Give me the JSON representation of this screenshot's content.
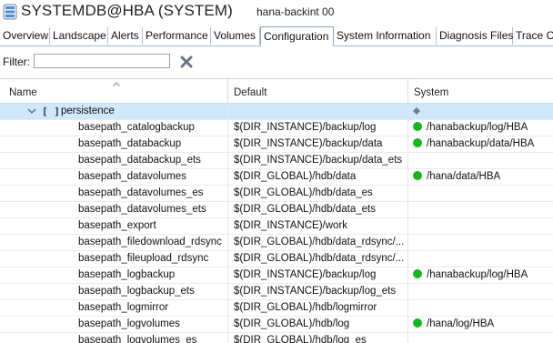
{
  "window": {
    "title": "SYSTEMDB@HBA (SYSTEM)",
    "subtitle": "hana-backint 00"
  },
  "tabs": [
    {
      "label": "Overview"
    },
    {
      "label": "Landscape"
    },
    {
      "label": "Alerts"
    },
    {
      "label": "Performance"
    },
    {
      "label": "Volumes"
    },
    {
      "label": "Configuration",
      "active": true
    },
    {
      "label": "System Information"
    },
    {
      "label": "Diagnosis Files"
    },
    {
      "label": "Trace C"
    }
  ],
  "filter": {
    "label": "Filter:",
    "value": ""
  },
  "table": {
    "columns": {
      "name": "Name",
      "default": "Default",
      "system": "System"
    },
    "section": {
      "bracket": "[ ]",
      "name": "persistence"
    },
    "rows": [
      {
        "name": "basepath_catalogbackup",
        "default": "$(DIR_INSTANCE)/backup/log",
        "system": "/hanabackup/log/HBA"
      },
      {
        "name": "basepath_databackup",
        "default": "$(DIR_INSTANCE)/backup/data",
        "system": "/hanabackup/data/HBA"
      },
      {
        "name": "basepath_databackup_ets",
        "default": "$(DIR_INSTANCE)/backup/data_ets",
        "system": ""
      },
      {
        "name": "basepath_datavolumes",
        "default": "$(DIR_GLOBAL)/hdb/data",
        "system": "/hana/data/HBA"
      },
      {
        "name": "basepath_datavolumes_es",
        "default": "$(DIR_GLOBAL)/hdb/data_es",
        "system": ""
      },
      {
        "name": "basepath_datavolumes_ets",
        "default": "$(DIR_GLOBAL)/hdb/data_ets",
        "system": ""
      },
      {
        "name": "basepath_export",
        "default": "$(DIR_INSTANCE)/work",
        "system": ""
      },
      {
        "name": "basepath_filedownload_rdsync",
        "default": "$(DIR_GLOBAL)/hdb/data_rdsync/...",
        "system": ""
      },
      {
        "name": "basepath_fileupload_rdsync",
        "default": "$(DIR_GLOBAL)/hdb/data_rdsync/...",
        "system": ""
      },
      {
        "name": "basepath_logbackup",
        "default": "$(DIR_INSTANCE)/backup/log",
        "system": "/hanabackup/log/HBA"
      },
      {
        "name": "basepath_logbackup_ets",
        "default": "$(DIR_INSTANCE)/backup/log_ets",
        "system": ""
      },
      {
        "name": "basepath_logmirror",
        "default": "$(DIR_GLOBAL)/hdb/logmirror",
        "system": ""
      },
      {
        "name": "basepath_logvolumes",
        "default": "$(DIR_GLOBAL)/hdb/log",
        "system": "/hana/log/HBA"
      },
      {
        "name": "basepath_logvolumes_es",
        "default": "$(DIR_GLOBAL)/hdb/log_es",
        "system": ""
      }
    ]
  },
  "colors": {
    "selected_row": "#cfe8fb",
    "status_dot": "#19b51f"
  }
}
